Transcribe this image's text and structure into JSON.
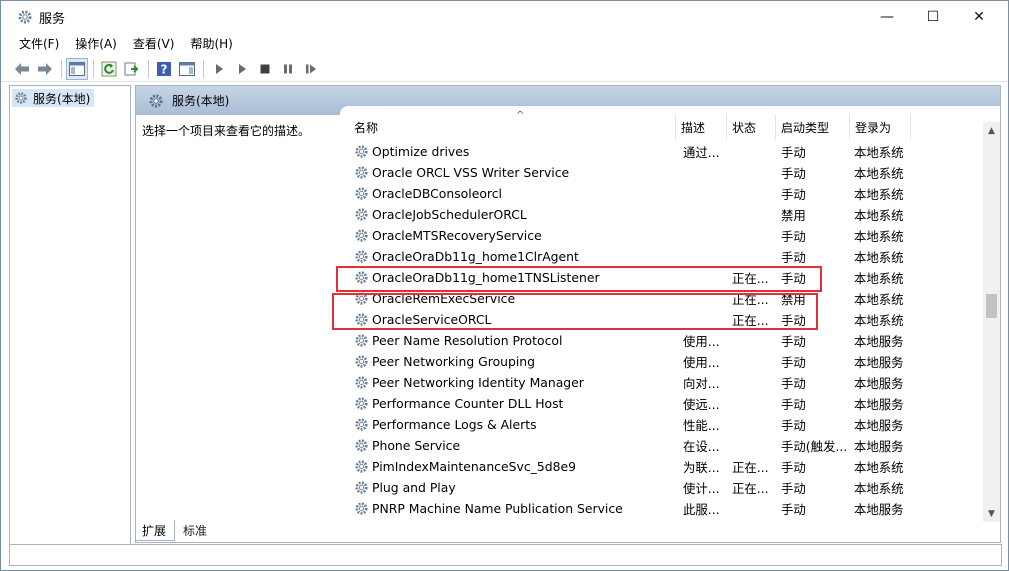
{
  "window": {
    "title": "服务",
    "minimize_icon": "minimize-icon",
    "maximize_icon": "maximize-icon",
    "close_icon": "close-icon",
    "min_glyph": "—",
    "max_glyph": "☐",
    "close_glyph": "✕"
  },
  "menu": [
    "文件(F)",
    "操作(A)",
    "查看(V)",
    "帮助(H)"
  ],
  "toolbar_icons": [
    "back-arrow-icon",
    "forward-arrow-icon",
    "show-hide-console-tree-icon",
    "refresh-icon",
    "export-list-icon",
    "help-icon",
    "show-action-pane-icon",
    "start-service-icon",
    "start-service-alt-icon",
    "stop-service-icon",
    "pause-service-icon",
    "restart-service-icon"
  ],
  "tree": {
    "root_label": "服务(本地)"
  },
  "pane": {
    "header_title": "服务(本地)",
    "description_hint": "选择一个项目来查看它的描述。"
  },
  "columns": {
    "name": "名称",
    "description": "描述",
    "status": "状态",
    "startup_type": "启动类型",
    "log_on_as": "登录为"
  },
  "services": [
    {
      "name": "Optimize drives",
      "description": "通过...",
      "status": "",
      "startup": "手动",
      "logon": "本地系统"
    },
    {
      "name": "Oracle ORCL VSS Writer Service",
      "description": "",
      "status": "",
      "startup": "手动",
      "logon": "本地系统"
    },
    {
      "name": "OracleDBConsoleorcl",
      "description": "",
      "status": "",
      "startup": "手动",
      "logon": "本地系统"
    },
    {
      "name": "OracleJobSchedulerORCL",
      "description": "",
      "status": "",
      "startup": "禁用",
      "logon": "本地系统"
    },
    {
      "name": "OracleMTSRecoveryService",
      "description": "",
      "status": "",
      "startup": "手动",
      "logon": "本地系统"
    },
    {
      "name": "OracleOraDb11g_home1ClrAgent",
      "description": "",
      "status": "",
      "startup": "手动",
      "logon": "本地系统"
    },
    {
      "name": "OracleOraDb11g_home1TNSListener",
      "description": "",
      "status": "正在...",
      "startup": "手动",
      "logon": "本地系统"
    },
    {
      "name": "OracleRemExecService",
      "description": "",
      "status": "正在...",
      "startup": "禁用",
      "logon": "本地系统"
    },
    {
      "name": "OracleServiceORCL",
      "description": "",
      "status": "正在...",
      "startup": "手动",
      "logon": "本地系统"
    },
    {
      "name": "Peer Name Resolution Protocol",
      "description": "使用...",
      "status": "",
      "startup": "手动",
      "logon": "本地服务"
    },
    {
      "name": "Peer Networking Grouping",
      "description": "使用...",
      "status": "",
      "startup": "手动",
      "logon": "本地服务"
    },
    {
      "name": "Peer Networking Identity Manager",
      "description": "向对...",
      "status": "",
      "startup": "手动",
      "logon": "本地服务"
    },
    {
      "name": "Performance Counter DLL Host",
      "description": "使远...",
      "status": "",
      "startup": "手动",
      "logon": "本地服务"
    },
    {
      "name": "Performance Logs & Alerts",
      "description": "性能...",
      "status": "",
      "startup": "手动",
      "logon": "本地服务"
    },
    {
      "name": "Phone Service",
      "description": "在设...",
      "status": "",
      "startup": "手动(触发...",
      "logon": "本地服务"
    },
    {
      "name": "PimIndexMaintenanceSvc_5d8e9",
      "description": "为联...",
      "status": "正在...",
      "startup": "手动",
      "logon": "本地系统"
    },
    {
      "name": "Plug and Play",
      "description": "使计...",
      "status": "正在...",
      "startup": "手动",
      "logon": "本地系统"
    },
    {
      "name": "PNRP Machine Name Publication Service",
      "description": "此服...",
      "status": "",
      "startup": "手动",
      "logon": "本地服务"
    }
  ],
  "bottom_tabs": [
    "扩展",
    "标准"
  ],
  "colors": {
    "highlight_box": "#e0303a",
    "pane_header": "#b8cadf",
    "tree_selected": "#d6e6f7"
  }
}
